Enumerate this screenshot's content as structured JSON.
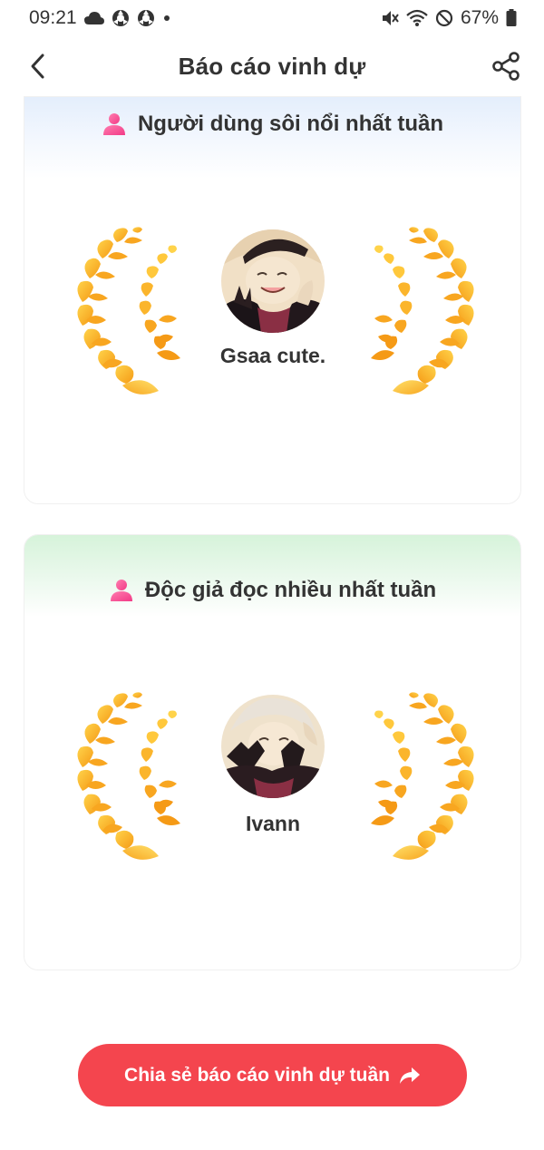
{
  "status_bar": {
    "time": "09:21",
    "battery": "67%",
    "icons": [
      "cloud-icon",
      "sync-icon",
      "sync-icon",
      "dot-icon",
      "mute-icon",
      "wifi-icon",
      "no-disturb-icon",
      "battery-icon"
    ]
  },
  "header": {
    "title": "Báo cáo vinh dự",
    "back_icon": "chevron-left-icon",
    "share_icon": "share-icon"
  },
  "cards": [
    {
      "title": "Người dùng sôi nổi nhất tuần",
      "user_name": "Gsaa cute.",
      "header_color": "#e4eefc"
    },
    {
      "title": "Độc giả đọc nhiều nhất tuần",
      "user_name": "Ivann",
      "header_color": "#d6f3da"
    }
  ],
  "footer": {
    "share_button_label": "Chia sẻ báo cáo vinh dự tuần",
    "share_button_color": "#f4454e"
  }
}
